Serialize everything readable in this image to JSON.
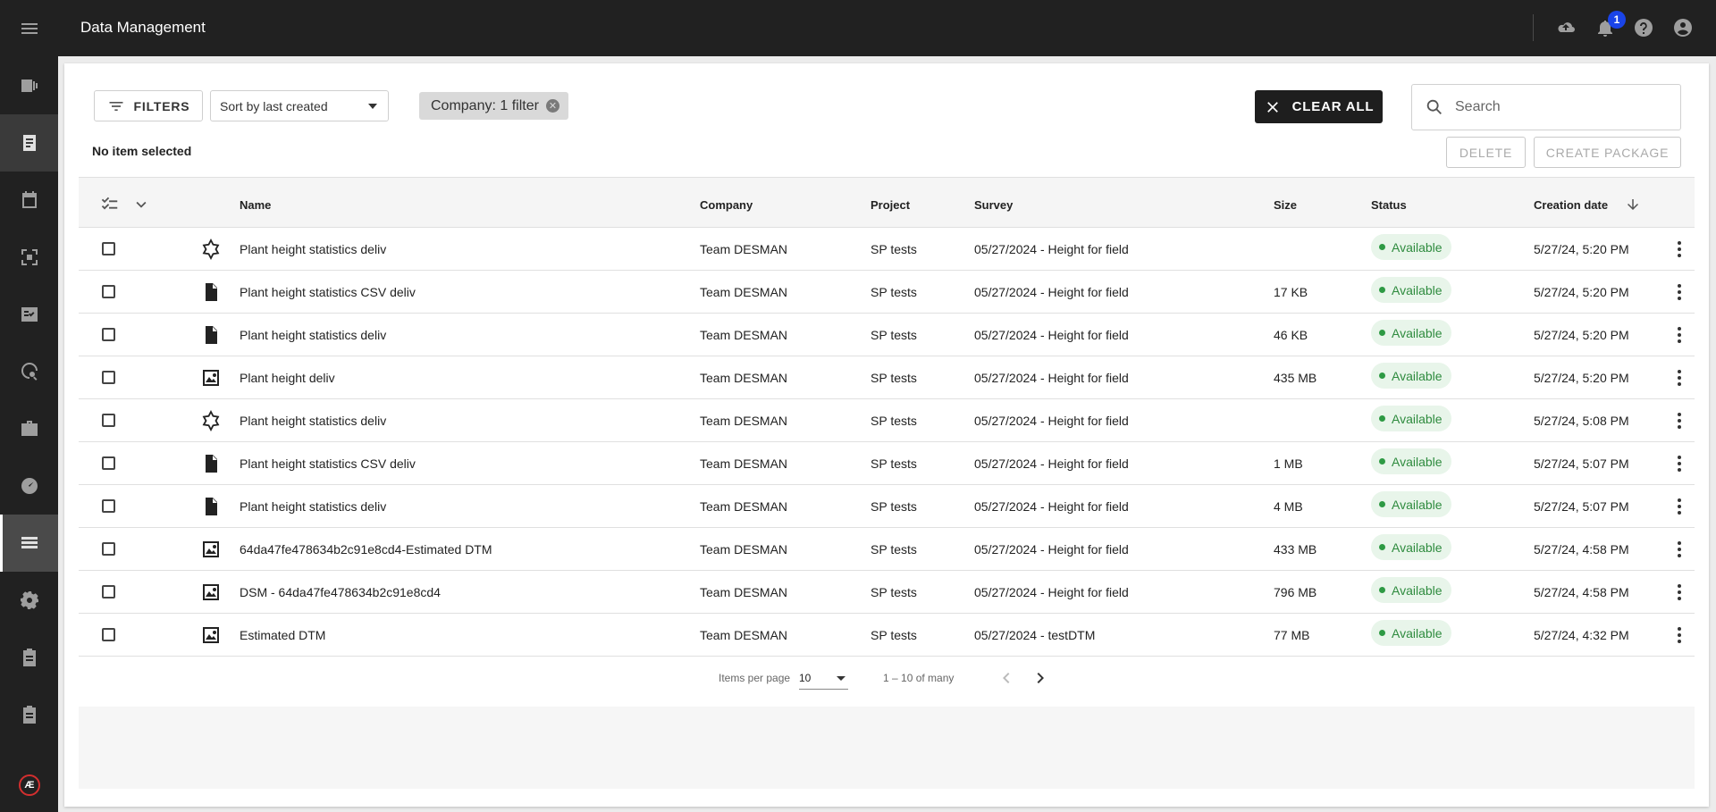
{
  "app": {
    "title": "Data Management"
  },
  "rail": {
    "items": [
      {
        "icon": "menu-icon"
      },
      {
        "icon": "map-panels-icon"
      },
      {
        "icon": "document-icon"
      },
      {
        "icon": "calendar-icon"
      },
      {
        "icon": "scan-focus-icon"
      },
      {
        "icon": "checklist-icon"
      },
      {
        "icon": "location-search-icon"
      },
      {
        "icon": "briefcase-icon"
      },
      {
        "icon": "gauge-icon"
      },
      {
        "icon": "storage-icon"
      },
      {
        "icon": "gear-icon"
      },
      {
        "icon": "clipboard-icon"
      },
      {
        "icon": "clipboard-icon"
      }
    ],
    "logo_text": "Æ"
  },
  "topbar": {
    "notification_count": "1",
    "icons": [
      "cloud-upload-icon",
      "bell-icon",
      "help-icon",
      "account-icon"
    ]
  },
  "toolbar": {
    "filters_label": "FILTERS",
    "sort_value": "Sort by last created",
    "chip_label": "Company: 1 filter",
    "clear_label": "CLEAR ALL",
    "search_placeholder": "Search",
    "selection_label": "No item selected",
    "delete_label": "DELETE",
    "package_label": "CREATE PACKAGE"
  },
  "table": {
    "columns": {
      "name": "Name",
      "company": "Company",
      "project": "Project",
      "survey": "Survey",
      "size": "Size",
      "status": "Status",
      "date": "Creation date"
    },
    "rows": [
      {
        "icon": "shape-icon",
        "name": "Plant height statistics deliv",
        "company": "Team DESMAN",
        "project": "SP tests",
        "survey": "05/27/2024 - Height for field",
        "size": "",
        "status": "Available",
        "date": "5/27/24, 5:20 PM"
      },
      {
        "icon": "file-icon",
        "name": "Plant height statistics CSV deliv",
        "company": "Team DESMAN",
        "project": "SP tests",
        "survey": "05/27/2024 - Height for field",
        "size": "17 KB",
        "status": "Available",
        "date": "5/27/24, 5:20 PM"
      },
      {
        "icon": "file-icon",
        "name": "Plant height statistics deliv",
        "company": "Team DESMAN",
        "project": "SP tests",
        "survey": "05/27/2024 - Height for field",
        "size": "46 KB",
        "status": "Available",
        "date": "5/27/24, 5:20 PM"
      },
      {
        "icon": "raster-icon",
        "name": "Plant height deliv",
        "company": "Team DESMAN",
        "project": "SP tests",
        "survey": "05/27/2024 - Height for field",
        "size": "435 MB",
        "status": "Available",
        "date": "5/27/24, 5:20 PM"
      },
      {
        "icon": "shape-icon",
        "name": "Plant height statistics deliv",
        "company": "Team DESMAN",
        "project": "SP tests",
        "survey": "05/27/2024 - Height for field",
        "size": "",
        "status": "Available",
        "date": "5/27/24, 5:08 PM"
      },
      {
        "icon": "file-icon",
        "name": "Plant height statistics CSV deliv",
        "company": "Team DESMAN",
        "project": "SP tests",
        "survey": "05/27/2024 - Height for field",
        "size": "1 MB",
        "status": "Available",
        "date": "5/27/24, 5:07 PM"
      },
      {
        "icon": "file-icon",
        "name": "Plant height statistics deliv",
        "company": "Team DESMAN",
        "project": "SP tests",
        "survey": "05/27/2024 - Height for field",
        "size": "4 MB",
        "status": "Available",
        "date": "5/27/24, 5:07 PM"
      },
      {
        "icon": "raster-icon",
        "name": "64da47fe478634b2c91e8cd4-Estimated DTM",
        "company": "Team DESMAN",
        "project": "SP tests",
        "survey": "05/27/2024 - Height for field",
        "size": "433 MB",
        "status": "Available",
        "date": "5/27/24, 4:58 PM"
      },
      {
        "icon": "raster-icon",
        "name": "DSM - 64da47fe478634b2c91e8cd4",
        "company": "Team DESMAN",
        "project": "SP tests",
        "survey": "05/27/2024 - Height for field",
        "size": "796 MB",
        "status": "Available",
        "date": "5/27/24, 4:58 PM"
      },
      {
        "icon": "raster-icon",
        "name": "Estimated DTM",
        "company": "Team DESMAN",
        "project": "SP tests",
        "survey": "05/27/2024 - testDTM",
        "size": "77 MB",
        "status": "Available",
        "date": "5/27/24, 4:32 PM"
      }
    ]
  },
  "pagination": {
    "items_label": "Items per page",
    "per_page": "10",
    "range": "1 – 10 of many"
  },
  "colors": {
    "rail_bg": "#212121",
    "accent_badge": "#1a44e8",
    "status_green": "#2e8b3e",
    "status_bg": "#e8f5ea"
  }
}
